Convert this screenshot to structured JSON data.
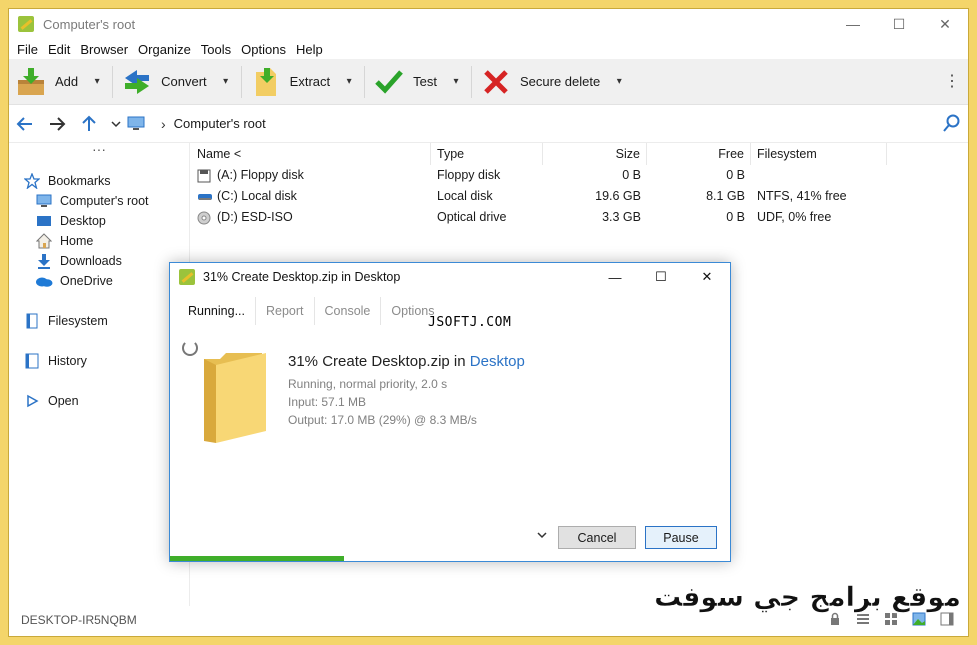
{
  "window": {
    "title": "Computer's root",
    "caption": {
      "minimize": "—",
      "maximize": "☐",
      "close": "✕"
    }
  },
  "menu": [
    "File",
    "Edit",
    "Browser",
    "Organize",
    "Tools",
    "Options",
    "Help"
  ],
  "toolbar": {
    "buttons": [
      {
        "label": "Add",
        "icon": "add-archive-icon"
      },
      {
        "label": "Convert",
        "icon": "convert-arrows-icon"
      },
      {
        "label": "Extract",
        "icon": "extract-folder-icon"
      },
      {
        "label": "Test",
        "icon": "checkmark-icon"
      },
      {
        "label": "Secure delete",
        "icon": "red-x-icon"
      }
    ],
    "more": "⋮"
  },
  "address": {
    "path": "Computer's root",
    "separator": "›"
  },
  "sidebar": {
    "dots": "···",
    "items": [
      {
        "label": "Bookmarks",
        "icon": "star-icon"
      },
      {
        "label": "Computer's root",
        "icon": "monitor-icon"
      },
      {
        "label": "Desktop",
        "icon": "desktop-icon"
      },
      {
        "label": "Home",
        "icon": "home-icon"
      },
      {
        "label": "Downloads",
        "icon": "download-icon"
      },
      {
        "label": "OneDrive",
        "icon": "cloud-icon"
      },
      {
        "label": "Filesystem",
        "icon": "file-icon"
      },
      {
        "label": "History",
        "icon": "history-icon"
      },
      {
        "label": "Open",
        "icon": "play-icon"
      }
    ]
  },
  "filelist": {
    "columns": [
      "Name <",
      "Type",
      "Size",
      "Free",
      "Filesystem"
    ],
    "rows": [
      {
        "name": "(A:) Floppy disk",
        "type": "Floppy disk",
        "size": "0 B",
        "free": "0 B",
        "fs": "",
        "icon": "floppy-icon"
      },
      {
        "name": "(C:) Local disk",
        "type": "Local disk",
        "size": "19.6 GB",
        "free": "8.1 GB",
        "fs": "NTFS, 41% free",
        "icon": "hard-drive-icon"
      },
      {
        "name": "(D:) ESD-ISO",
        "type": "Optical drive",
        "size": "3.3 GB",
        "free": "0 B",
        "fs": "UDF, 0% free",
        "icon": "optical-disc-icon"
      }
    ]
  },
  "status": {
    "computer": "DESKTOP-IR5NQBM"
  },
  "dialog": {
    "title": "31% Create Desktop.zip in Desktop",
    "tabs": [
      "Running...",
      "Report",
      "Console",
      "Options"
    ],
    "watermark": "JSOFTJ.COM",
    "heading_prefix": "31% Create Desktop.zip in ",
    "heading_link": "Desktop",
    "status_line": "Running, normal priority, 2.0 s",
    "input_line": "Input: 57.1 MB",
    "output_line": "Output: 17.0 MB (29%) @ 8.3 MB/s",
    "cancel": "Cancel",
    "pause": "Pause",
    "progress": 0.31
  },
  "arabic_watermark": "موقع برامج جي سوفت",
  "colors": {
    "accent": "#2b73c6",
    "progress": "#3fae2a",
    "frame": "#f4d56a"
  }
}
